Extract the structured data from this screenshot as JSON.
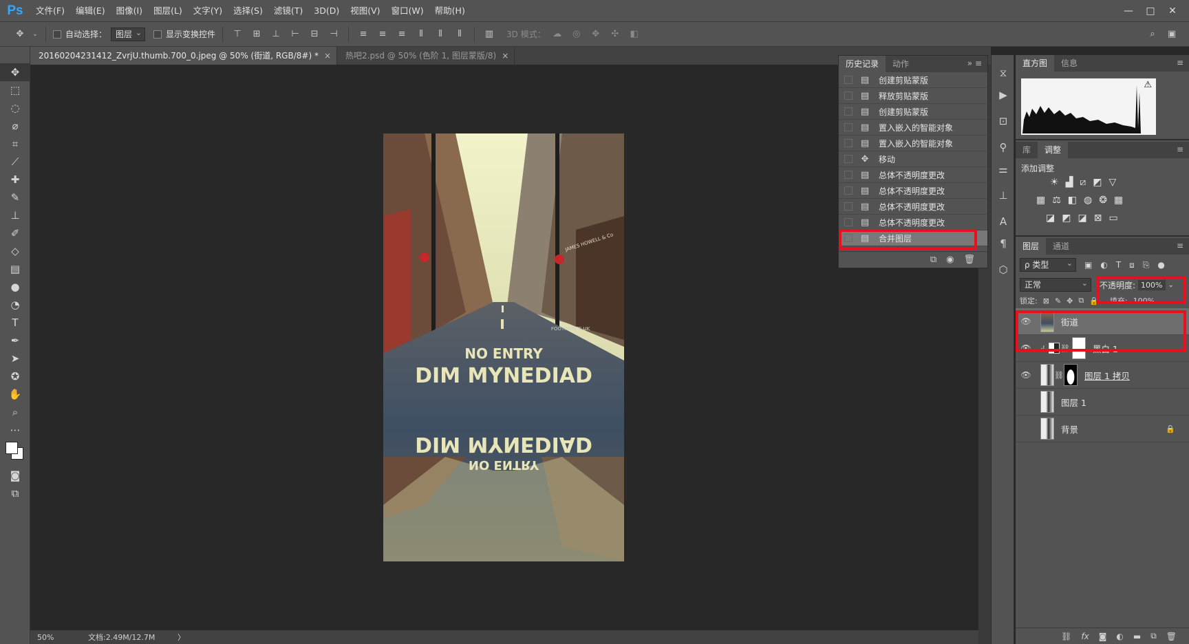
{
  "app": {
    "logo": "Ps"
  },
  "menu": [
    "文件(F)",
    "编辑(E)",
    "图像(I)",
    "图层(L)",
    "文字(Y)",
    "选择(S)",
    "滤镜(T)",
    "3D(D)",
    "视图(V)",
    "窗口(W)",
    "帮助(H)"
  ],
  "window_controls": {
    "minimize": "—",
    "restore": "□",
    "close": "✕"
  },
  "options": {
    "auto_select_label": "自动选择：",
    "auto_select_value": "图层",
    "show_transform_label": "显示变换控件",
    "mode_3d_label": "3D 模式："
  },
  "tabs": [
    {
      "label": "20160204231412_ZvrjU.thumb.700_0.jpeg @ 50% (街道, RGB/8#) *",
      "close": "×"
    },
    {
      "label": "热吧2.psd @ 50% (色阶 1, 图层蒙版/8)",
      "close": "×"
    }
  ],
  "image_text": {
    "line1": "NO ENTRY",
    "line2": "DIM MYNEDIAD",
    "watermark": "FOOTPRINTS UK",
    "sign": "JAMES HOWELL & Co"
  },
  "status": {
    "zoom": "50%",
    "doc": "文档:2.49M/12.7M",
    "arrow": "〉"
  },
  "history_panel": {
    "tabs": [
      "历史记录",
      "动作"
    ],
    "items": [
      "创建剪贴蒙版",
      "释放剪贴蒙版",
      "创建剪贴蒙版",
      "置入嵌入的智能对象",
      "置入嵌入的智能对象",
      "移动",
      "总体不透明度更改",
      "总体不透明度更改",
      "总体不透明度更改",
      "总体不透明度更改",
      "合并图层"
    ]
  },
  "histogram_panel": {
    "tabs": [
      "直方图",
      "信息"
    ],
    "warning": "⚠"
  },
  "adjust_panel": {
    "tabs": [
      "库",
      "调整"
    ],
    "title": "添加调整"
  },
  "layers_panel": {
    "tabs": [
      "图层",
      "通道"
    ],
    "filter_kind": "ρ 类型",
    "blend_mode": "正常",
    "opacity_label": "不透明度:",
    "opacity_value": "100%",
    "lock_label": "锁定:",
    "fill_label": "填充:",
    "fill_value": "100%",
    "layers": [
      {
        "name": "街道",
        "visible": true,
        "selected": true
      },
      {
        "name": "黑白 1",
        "visible": true,
        "selected": false
      },
      {
        "name": "图层 1 拷贝",
        "visible": true,
        "selected": false
      },
      {
        "name": "图层 1",
        "visible": false,
        "selected": false
      },
      {
        "name": "背景",
        "visible": false,
        "selected": false
      }
    ],
    "footer_fx": "fx"
  },
  "colors": {
    "ps_blue": "#31a8ff",
    "highlight_red": "#e8101e",
    "panel_bg": "#535353",
    "canvas_bg": "#282828"
  }
}
